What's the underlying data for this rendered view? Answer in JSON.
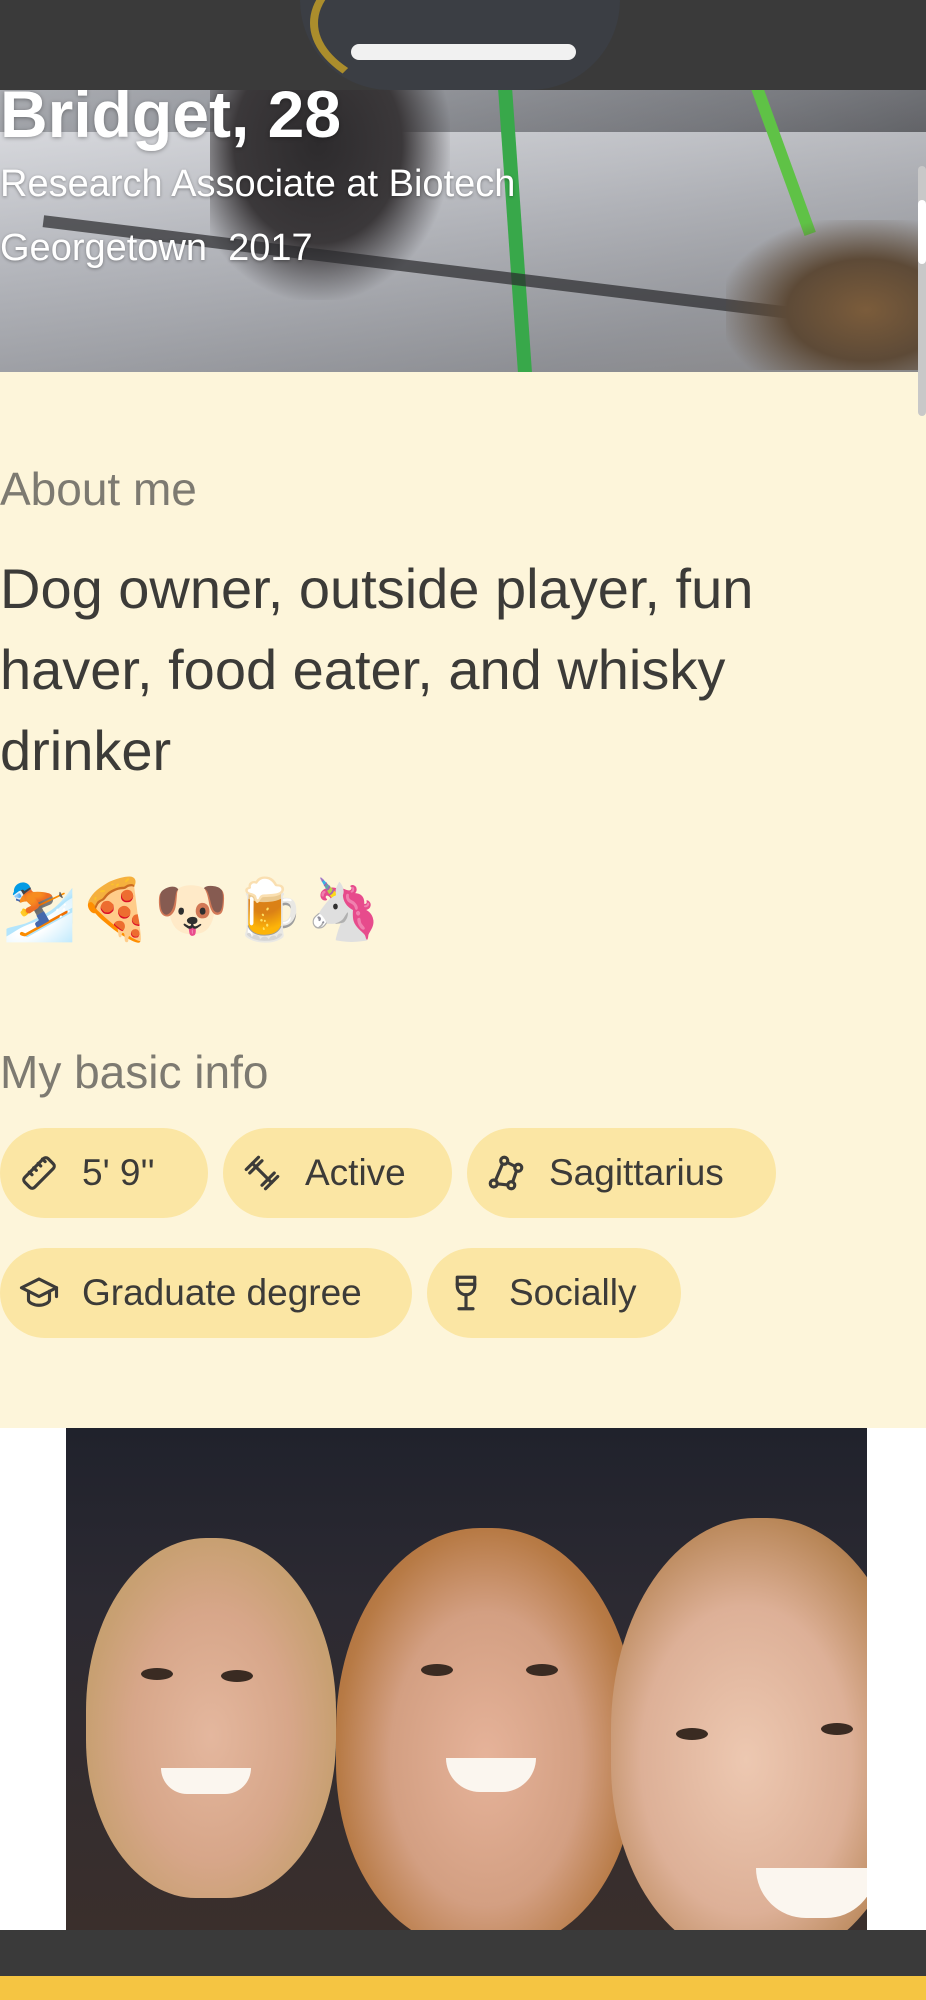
{
  "profile": {
    "name_age": "Bridget, 28",
    "job": "Research Associate at Biotech",
    "school": "Georgetown  2017"
  },
  "about": {
    "label": "About me",
    "text": "Dog owner, outside player, fun haver, food eater, and whisky drinker",
    "emojis": [
      "⛷️",
      "🍕",
      "🐶",
      "🍺",
      "🦄"
    ]
  },
  "basic_info": {
    "label": "My basic info",
    "chips": [
      {
        "icon": "ruler-icon",
        "label": "5' 9''"
      },
      {
        "icon": "dumbbell-icon",
        "label": "Active"
      },
      {
        "icon": "constellation-icon",
        "label": "Sagittarius"
      },
      {
        "icon": "graduation-cap-icon",
        "label": "Graduate degree"
      },
      {
        "icon": "wine-glass-icon",
        "label": "Socially"
      }
    ]
  },
  "colors": {
    "background": "#fdf5da",
    "chip": "#fbe6a4",
    "accent": "#f5c542",
    "text": "#3c3b38",
    "muted_text": "#7d7a71"
  }
}
